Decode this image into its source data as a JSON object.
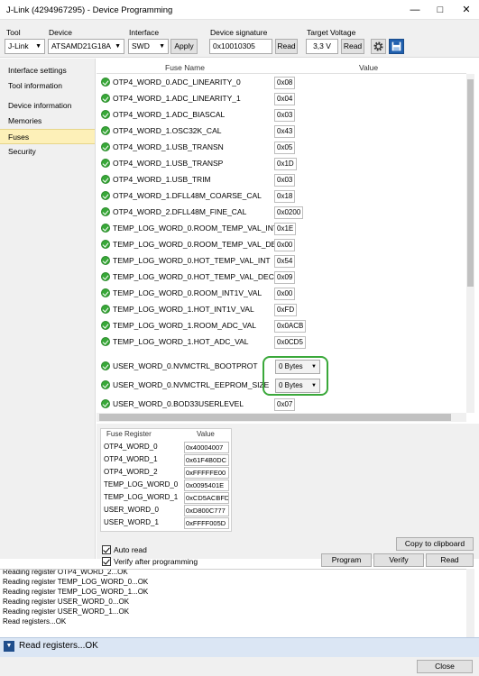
{
  "window": {
    "title": "J-Link (4294967295) - Device Programming",
    "minimize": "—",
    "maximize": "□",
    "close": "✕"
  },
  "toolbar": {
    "tool_label": "Tool",
    "tool_value": "J-Link",
    "device_label": "Device",
    "device_value": "ATSAMD21G18A",
    "interface_label": "Interface",
    "interface_value": "SWD",
    "apply_label": "Apply",
    "signature_label": "Device signature",
    "signature_value": "0x10010305",
    "read_label": "Read",
    "voltage_label": "Target Voltage",
    "voltage_value": "3,3 V",
    "voltage_read_label": "Read",
    "gear_icon": "gear-icon",
    "save_icon": "save-icon"
  },
  "nav": {
    "items": [
      {
        "label": "Interface settings"
      },
      {
        "label": "Tool information"
      },
      {
        "label": "Device information"
      },
      {
        "label": "Memories"
      },
      {
        "label": "Fuses"
      },
      {
        "label": "Security"
      }
    ],
    "selected": "Fuses"
  },
  "fuses": {
    "col_name": "Fuse Name",
    "col_value": "Value",
    "rows": [
      {
        "name": "OTP4_WORD_0.ADC_LINEARITY_0",
        "value": "0x08"
      },
      {
        "name": "OTP4_WORD_1.ADC_LINEARITY_1",
        "value": "0x04"
      },
      {
        "name": "OTP4_WORD_1.ADC_BIASCAL",
        "value": "0x03"
      },
      {
        "name": "OTP4_WORD_1.OSC32K_CAL",
        "value": "0x43"
      },
      {
        "name": "OTP4_WORD_1.USB_TRANSN",
        "value": "0x05"
      },
      {
        "name": "OTP4_WORD_1.USB_TRANSP",
        "value": "0x1D"
      },
      {
        "name": "OTP4_WORD_1.USB_TRIM",
        "value": "0x03"
      },
      {
        "name": "OTP4_WORD_1.DFLL48M_COARSE_CAL",
        "value": "0x18"
      },
      {
        "name": "OTP4_WORD_2.DFLL48M_FINE_CAL",
        "value": "0x0200"
      },
      {
        "name": "TEMP_LOG_WORD_0.ROOM_TEMP_VAL_INT",
        "value": "0x1E"
      },
      {
        "name": "TEMP_LOG_WORD_0.ROOM_TEMP_VAL_DEC",
        "value": "0x00"
      },
      {
        "name": "TEMP_LOG_WORD_0.HOT_TEMP_VAL_INT",
        "value": "0x54"
      },
      {
        "name": "TEMP_LOG_WORD_0.HOT_TEMP_VAL_DEC",
        "value": "0x09"
      },
      {
        "name": "TEMP_LOG_WORD_0.ROOM_INT1V_VAL",
        "value": "0x00"
      },
      {
        "name": "TEMP_LOG_WORD_1.HOT_INT1V_VAL",
        "value": "0xFD"
      },
      {
        "name": "TEMP_LOG_WORD_1.ROOM_ADC_VAL",
        "value": "0x0ACB"
      },
      {
        "name": "TEMP_LOG_WORD_1.HOT_ADC_VAL",
        "value": "0x0CD5"
      },
      {
        "name": "USER_WORD_0.NVMCTRL_BOOTPROT",
        "value": "0 Bytes",
        "select": true
      },
      {
        "name": "USER_WORD_0.NVMCTRL_EEPROM_SIZE",
        "value": "0 Bytes",
        "select": true
      },
      {
        "name": "USER_WORD_0.BOD33USERLEVEL",
        "value": "0x07"
      }
    ]
  },
  "registers": {
    "col_name": "Fuse Register",
    "col_value": "Value",
    "rows": [
      {
        "name": "OTP4_WORD_0",
        "value": "0x40004007"
      },
      {
        "name": "OTP4_WORD_1",
        "value": "0x61F4B0DC"
      },
      {
        "name": "OTP4_WORD_2",
        "value": "0xFFFFFE00"
      },
      {
        "name": "TEMP_LOG_WORD_0",
        "value": "0x0095401E"
      },
      {
        "name": "TEMP_LOG_WORD_1",
        "value": "0xCD5ACBFD"
      },
      {
        "name": "USER_WORD_0",
        "value": "0xD800C777"
      },
      {
        "name": "USER_WORD_1",
        "value": "0xFFFF005D"
      }
    ]
  },
  "options": {
    "auto_read": "Auto read",
    "verify_after": "Verify after programming"
  },
  "actions": {
    "copy": "Copy to clipboard",
    "program": "Program",
    "verify": "Verify",
    "read": "Read"
  },
  "log": {
    "lines": [
      "Reading register OTP4_WORD_2...OK",
      "Reading register TEMP_LOG_WORD_0...OK",
      "Reading register TEMP_LOG_WORD_1...OK",
      "Reading register USER_WORD_0...OK",
      "Reading register USER_WORD_1...OK",
      "Read registers...OK"
    ]
  },
  "status": {
    "text": "Read registers...OK",
    "icon": "chevron-down-icon"
  },
  "footer": {
    "close": "Close"
  },
  "colors": {
    "selected_nav": "#fdf0b8",
    "status_bar": "#dbe6f4",
    "check_green": "#38a838",
    "highlight_green": "#3aa83a"
  }
}
